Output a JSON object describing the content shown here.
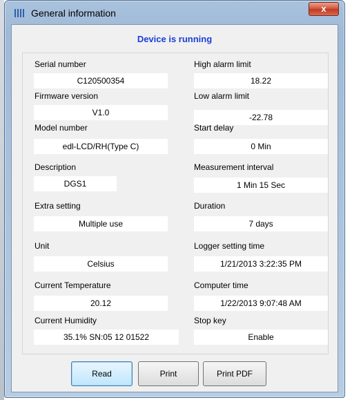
{
  "window": {
    "title": "General information",
    "close_label": "x"
  },
  "status": "Device is running",
  "left_fields": [
    {
      "label": "Serial number",
      "value": "C120500354"
    },
    {
      "label": "Firmware version",
      "value": "V1.0"
    },
    {
      "label": "Model number",
      "value": "edl-LCD/RH(Type C)"
    },
    {
      "label": "Description",
      "value": "DGS1"
    },
    {
      "label": "Extra setting",
      "value": "Multiple use"
    },
    {
      "label": "Unit",
      "value": "Celsius"
    },
    {
      "label": "Current Temperature",
      "value": "20.12"
    },
    {
      "label": "Current Humidity",
      "value": "35.1%  SN:05 12 01522"
    }
  ],
  "right_fields": [
    {
      "label": "High alarm limit",
      "value": "18.22"
    },
    {
      "label": "Low alarm limit",
      "value": "-22.78"
    },
    {
      "label": "Start delay",
      "value": "0 Min"
    },
    {
      "label": "Measurement interval",
      "value": "1 Min 15 Sec"
    },
    {
      "label": "Duration",
      "value": "7 days"
    },
    {
      "label": "Logger setting time",
      "value": "1/21/2013 3:22:35 PM"
    },
    {
      "label": "Computer time",
      "value": "1/22/2013 9:07:48 AM"
    },
    {
      "label": "Stop key",
      "value": "Enable"
    }
  ],
  "buttons": {
    "read": "Read",
    "print": "Print",
    "print_pdf": "Print PDF"
  },
  "colors": {
    "status_text": "#1c3ed6",
    "close_button": "#c03a22",
    "title_bar": "#a9c2dd"
  },
  "icons": {
    "app": "bars-icon",
    "close": "close-icon"
  }
}
